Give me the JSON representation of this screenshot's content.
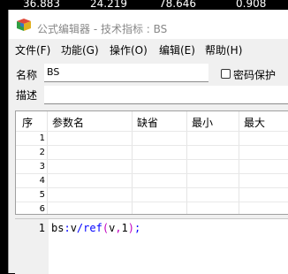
{
  "background_ticker": [
    "36.883",
    "24.219",
    "78.646",
    "0.908"
  ],
  "window": {
    "title": "公式编辑器 - 技术指标 : BS",
    "icon": "app-cube-icon"
  },
  "menu": [
    "文件(F)",
    "功能(G)",
    "操作(O)",
    "编辑(E)",
    "帮助(H)"
  ],
  "form": {
    "name_label": "名称",
    "name_value": "BS",
    "password_label": "密码保护",
    "password_checked": false,
    "desc_label": "描述",
    "desc_value": ""
  },
  "params_table": {
    "columns": [
      "序",
      "参数名",
      "缺省",
      "最小",
      "最大"
    ],
    "rows": [
      "1",
      "2",
      "3",
      "4",
      "5",
      "6"
    ]
  },
  "editor": {
    "line_numbers": [
      "1"
    ],
    "tokens": [
      {
        "text": "bs",
        "color": "#000000"
      },
      {
        "text": ":",
        "color": "#0000ff"
      },
      {
        "text": "v",
        "color": "#000000"
      },
      {
        "text": "/",
        "color": "#0000ff"
      },
      {
        "text": "ref",
        "color": "#0000ff"
      },
      {
        "text": "(",
        "color": "#c000c0"
      },
      {
        "text": "v",
        "color": "#000000"
      },
      {
        "text": ",",
        "color": "#c000c0"
      },
      {
        "text": "1",
        "color": "#000000"
      },
      {
        "text": ")",
        "color": "#c000c0"
      },
      {
        "text": ";",
        "color": "#0000ff"
      }
    ]
  },
  "colors": {
    "window_bg": "#f0f0f0",
    "title_text": "#888888",
    "keyword": "#0000ff",
    "paren": "#c000c0"
  }
}
